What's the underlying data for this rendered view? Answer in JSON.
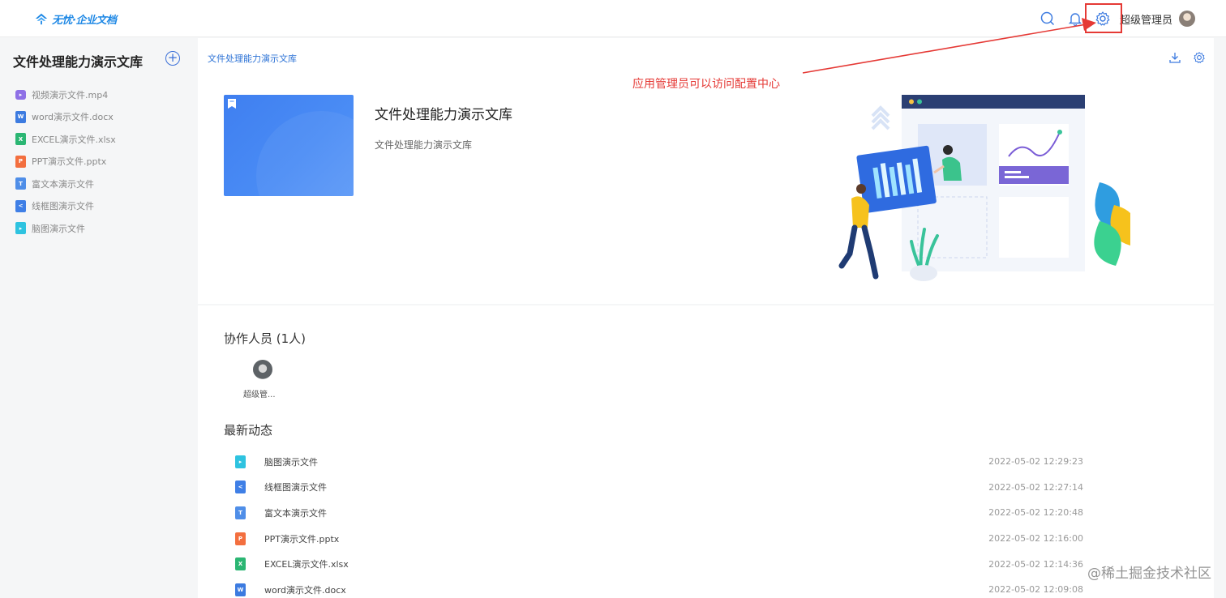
{
  "brand": {
    "logo_text": "无忧·企业文档"
  },
  "header": {
    "user_name": "超级管理员",
    "icons": [
      "search-icon",
      "bell-icon",
      "gear-icon"
    ]
  },
  "sidebar": {
    "title": "文件处理能力演示文库",
    "items": [
      {
        "label": "视频演示文件.mp4",
        "type": "video"
      },
      {
        "label": "word演示文件.docx",
        "type": "word"
      },
      {
        "label": "EXCEL演示文件.xlsx",
        "type": "excel"
      },
      {
        "label": "PPT演示文件.pptx",
        "type": "ppt"
      },
      {
        "label": "富文本演示文件",
        "type": "rich"
      },
      {
        "label": "线框图演示文件",
        "type": "wire"
      },
      {
        "label": "脑图演示文件",
        "type": "mind"
      }
    ]
  },
  "main": {
    "breadcrumb": "文件处理能力演示文库",
    "library_title": "文件处理能力演示文库",
    "library_desc": "文件处理能力演示文库",
    "annotation": "应用管理员可以访问配置中心",
    "collaborators_title": "协作人员 (1人)",
    "collaborator_name": "超级管...",
    "activity_title": "最新动态",
    "activities": [
      {
        "name": "脑图演示文件",
        "time": "2022-05-02 12:29:23",
        "type": "mind"
      },
      {
        "name": "线框图演示文件",
        "time": "2022-05-02 12:27:14",
        "type": "wire"
      },
      {
        "name": "富文本演示文件",
        "time": "2022-05-02 12:20:48",
        "type": "rich"
      },
      {
        "name": "PPT演示文件.pptx",
        "time": "2022-05-02 12:16:00",
        "type": "ppt"
      },
      {
        "name": "EXCEL演示文件.xlsx",
        "time": "2022-05-02 12:14:36",
        "type": "excel"
      },
      {
        "name": "word演示文件.docx",
        "time": "2022-05-02 12:09:08",
        "type": "word"
      }
    ]
  },
  "watermark": "@稀土掘金技术社区",
  "colors": {
    "accent": "#2d73d6",
    "annotation": "#e53935",
    "cover": "#4285f4"
  }
}
